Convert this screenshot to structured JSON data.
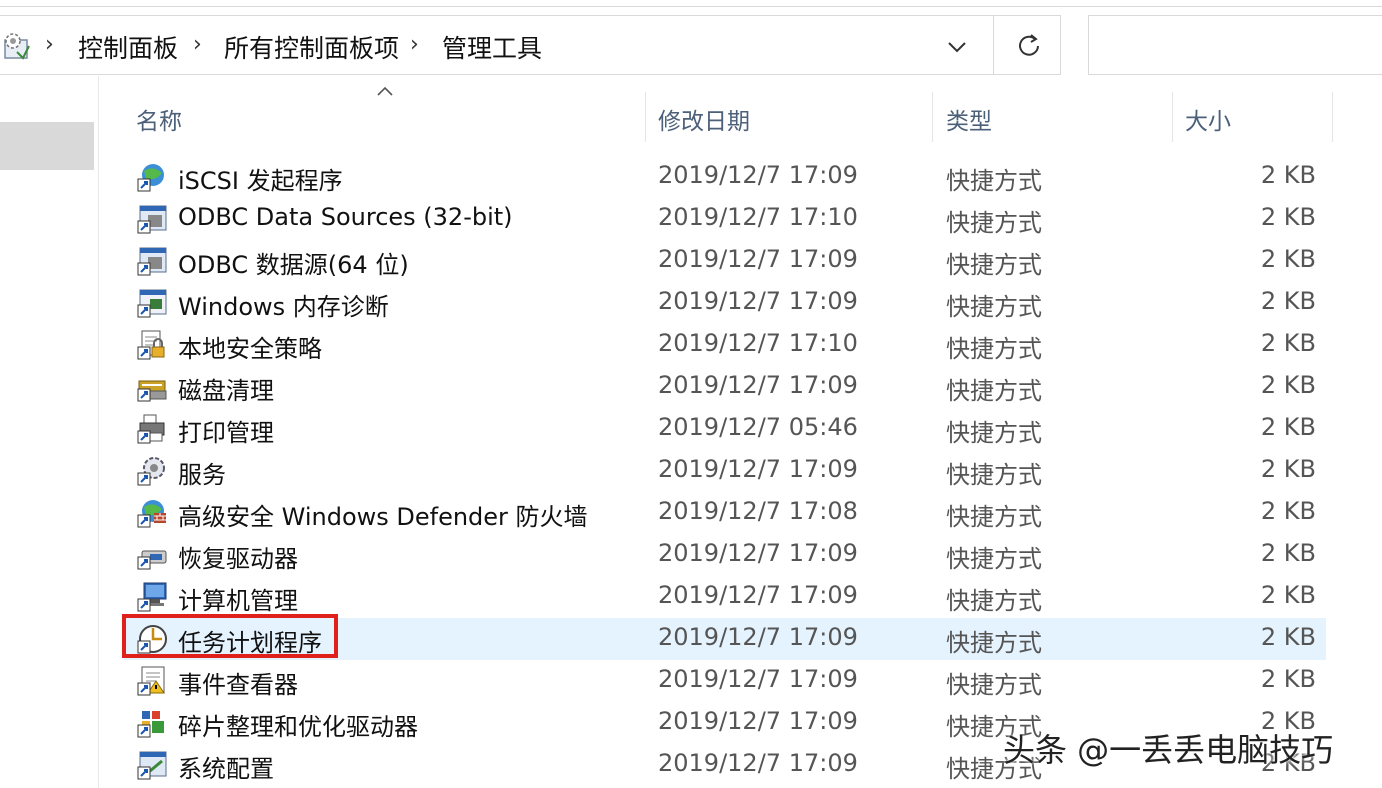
{
  "address_bar": {
    "breadcrumbs": [
      "控制面板",
      "所有控制面板项",
      "管理工具"
    ],
    "search_placeholder": ""
  },
  "columns": {
    "name": "名称",
    "date": "修改日期",
    "type": "类型",
    "size": "大小"
  },
  "files": [
    {
      "name": "iSCSI 发起程序",
      "date": "2019/12/7 17:09",
      "type": "快捷方式",
      "size": "2 KB",
      "icon": "iscsi-globe-icon"
    },
    {
      "name": "ODBC Data Sources (32-bit)",
      "date": "2019/12/7 17:10",
      "type": "快捷方式",
      "size": "2 KB",
      "icon": "odbc-icon"
    },
    {
      "name": "ODBC 数据源(64 位)",
      "date": "2019/12/7 17:09",
      "type": "快捷方式",
      "size": "2 KB",
      "icon": "odbc-icon"
    },
    {
      "name": "Windows 内存诊断",
      "date": "2019/12/7 17:09",
      "type": "快捷方式",
      "size": "2 KB",
      "icon": "memory-diagnostic-icon"
    },
    {
      "name": "本地安全策略",
      "date": "2019/12/7 17:10",
      "type": "快捷方式",
      "size": "2 KB",
      "icon": "security-policy-icon"
    },
    {
      "name": "磁盘清理",
      "date": "2019/12/7 17:09",
      "type": "快捷方式",
      "size": "2 KB",
      "icon": "disk-cleanup-icon"
    },
    {
      "name": "打印管理",
      "date": "2019/12/7 05:46",
      "type": "快捷方式",
      "size": "2 KB",
      "icon": "print-management-icon"
    },
    {
      "name": "服务",
      "date": "2019/12/7 17:09",
      "type": "快捷方式",
      "size": "2 KB",
      "icon": "services-gear-icon"
    },
    {
      "name": "高级安全 Windows Defender 防火墙",
      "date": "2019/12/7 17:08",
      "type": "快捷方式",
      "size": "2 KB",
      "icon": "firewall-globe-icon"
    },
    {
      "name": "恢复驱动器",
      "date": "2019/12/7 17:09",
      "type": "快捷方式",
      "size": "2 KB",
      "icon": "recovery-drive-icon"
    },
    {
      "name": "计算机管理",
      "date": "2019/12/7 17:09",
      "type": "快捷方式",
      "size": "2 KB",
      "icon": "computer-management-icon"
    },
    {
      "name": "任务计划程序",
      "date": "2019/12/7 17:09",
      "type": "快捷方式",
      "size": "2 KB",
      "icon": "task-scheduler-clock-icon",
      "selected": true
    },
    {
      "name": "事件查看器",
      "date": "2019/12/7 17:09",
      "type": "快捷方式",
      "size": "2 KB",
      "icon": "event-viewer-icon"
    },
    {
      "name": "碎片整理和优化驱动器",
      "date": "2019/12/7 17:09",
      "type": "快捷方式",
      "size": "2 KB",
      "icon": "defrag-icon"
    },
    {
      "name": "系统配置",
      "date": "2019/12/7 17:09",
      "type": "快捷方式",
      "size": "2 KB",
      "icon": "system-config-icon"
    }
  ],
  "watermark": "头条 @一丢丢电脑技巧",
  "colors": {
    "header_text": "#4c607a",
    "selection_bg": "#e5f3ff",
    "highlight_border": "#e0211b"
  }
}
